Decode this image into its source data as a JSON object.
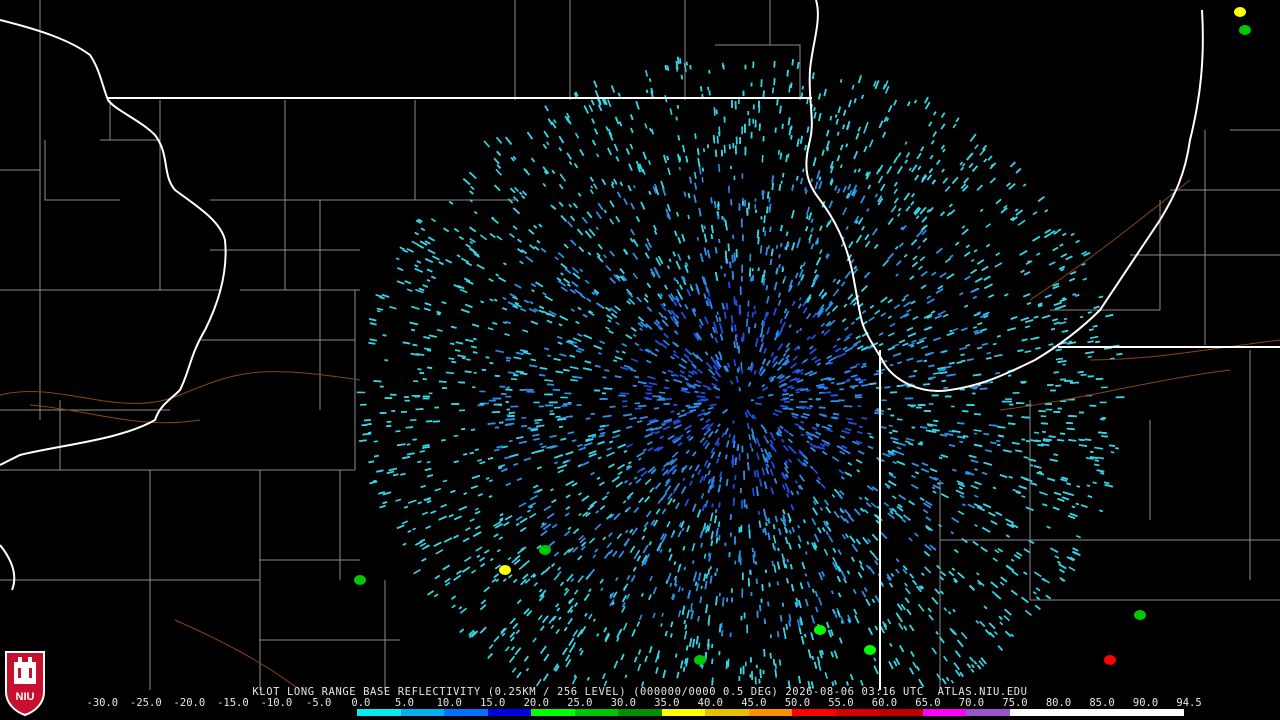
{
  "product": {
    "caption": "KLOT LONG RANGE BASE REFLECTIVITY (0.25KM / 256 LEVEL) (000000/0000 0.5 DEG) 2026-08-06 03:16 UTC  ATLAS.NIU.EDU"
  },
  "logo": {
    "text": "NIU"
  },
  "color_scale": {
    "labels": [
      "-30.0",
      "-25.0",
      "-20.0",
      "-15.0",
      "-10.0",
      "-5.0",
      "0.0",
      "5.0",
      "10.0",
      "15.0",
      "20.0",
      "25.0",
      "30.0",
      "35.0",
      "40.0",
      "45.0",
      "50.0",
      "55.0",
      "60.0",
      "65.0",
      "70.0",
      "75.0",
      "80.0",
      "85.0",
      "90.0",
      "94.5"
    ],
    "colors": [
      "#000000",
      "#000000",
      "#000000",
      "#000000",
      "#000000",
      "#000000",
      "#00eeee",
      "#00b0f0",
      "#0070ff",
      "#0000e8",
      "#00ff00",
      "#00c800",
      "#009000",
      "#ffff00",
      "#e8c000",
      "#ff9000",
      "#ff0000",
      "#d60000",
      "#c00000",
      "#ff00ff",
      "#9955c9",
      "#ffffff",
      "#ffffff",
      "#ffffff",
      "#ffffff"
    ]
  },
  "map_colors": {
    "state_border": "#ffffff",
    "county_border": "#8c8c8c",
    "highway": "#8b4513",
    "echo_light": "#33d6e6",
    "echo_medium": "#2a8fe8",
    "echo_heavy": "#1f4de0"
  }
}
